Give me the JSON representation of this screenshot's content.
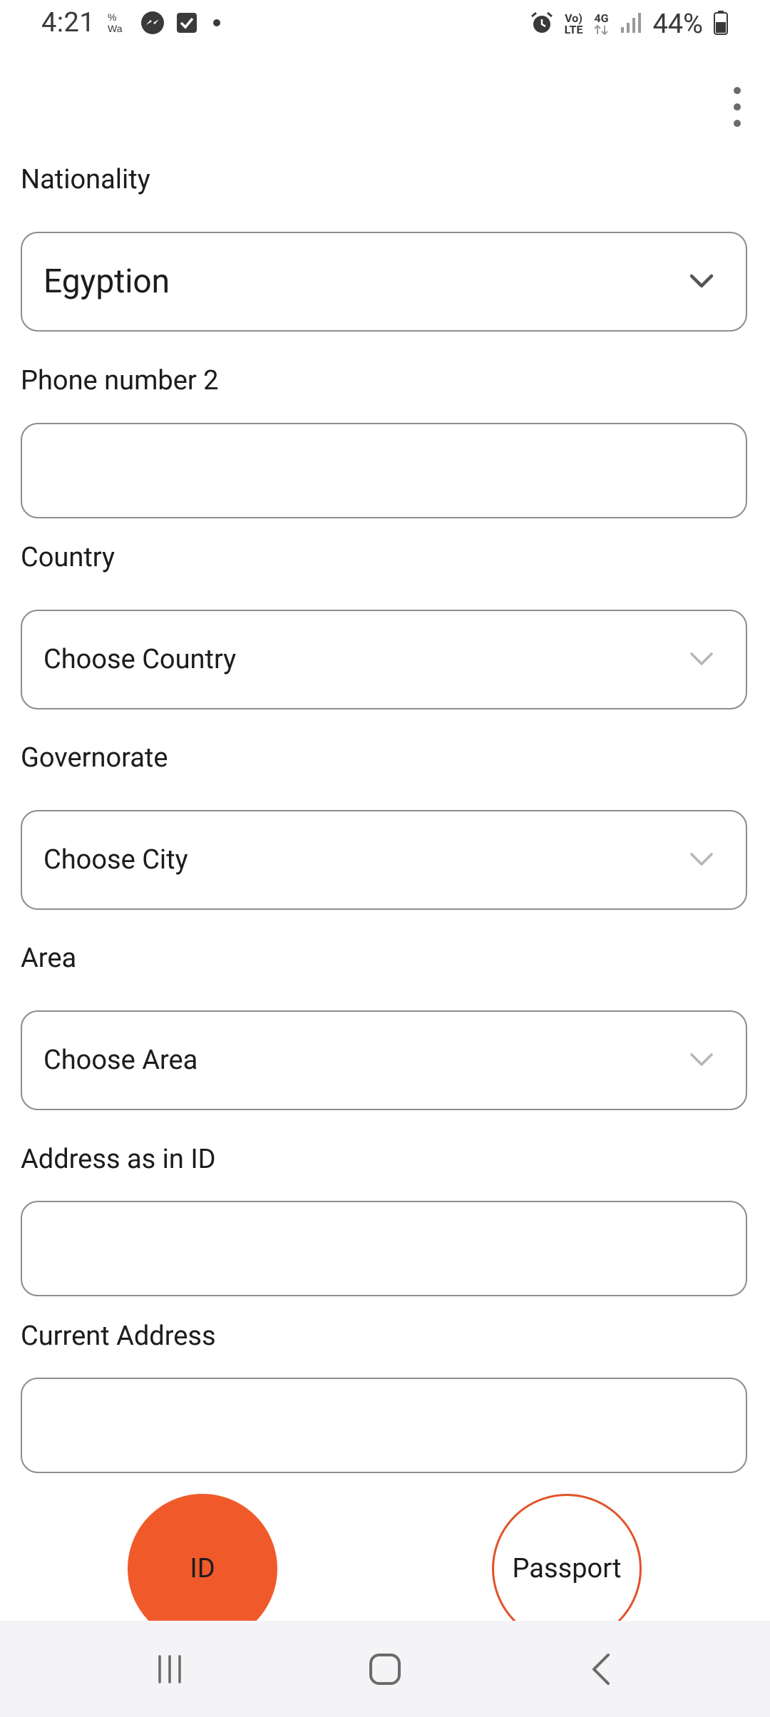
{
  "status_bar": {
    "time": "4:21",
    "battery_percent": "44%",
    "network_label_top": "Vo)",
    "network_label_bottom": "LTE",
    "network_type": "4G",
    "icons_left": [
      "wifi-calling-icon",
      "messenger-icon",
      "checkbox-app-icon",
      "notification-dot-icon"
    ],
    "icons_right": [
      "alarm-icon",
      "volte-icon",
      "4g-data-icon",
      "signal-icon",
      "battery-icon"
    ]
  },
  "toolbar": {
    "menu_icon": "more-vert-icon"
  },
  "form": {
    "nationality": {
      "label": "Nationality",
      "value": "Egyption"
    },
    "phone2": {
      "label": "Phone number 2",
      "value": ""
    },
    "country": {
      "label": "Country",
      "placeholder": "Choose Country"
    },
    "governorate": {
      "label": "Governorate",
      "placeholder": "Choose City"
    },
    "area": {
      "label": "Area",
      "placeholder": "Choose Area"
    },
    "address_id": {
      "label": "Address as in ID",
      "value": ""
    },
    "current_address": {
      "label": "Current Address",
      "value": ""
    }
  },
  "doc_type": {
    "id_label": "ID",
    "passport_label": "Passport",
    "selected": "ID"
  },
  "colors": {
    "accent": "#f05a2b",
    "border": "#8e8e8e",
    "text": "#1c1c1c",
    "nav_bg": "#f4f4f6"
  },
  "nav_bar": {
    "icons": [
      "recent-apps-icon",
      "home-icon",
      "back-icon"
    ]
  }
}
